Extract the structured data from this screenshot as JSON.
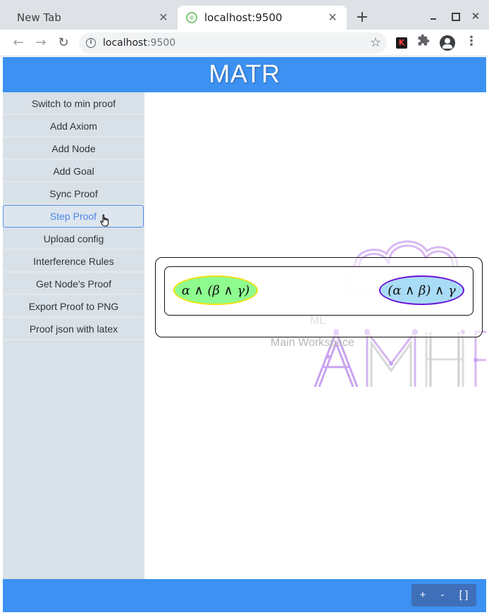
{
  "browser": {
    "tabs": [
      {
        "label": "New Tab",
        "active": false
      },
      {
        "label": "localhost:9500",
        "active": true
      }
    ],
    "tab_close_glyph": "✕",
    "new_tab_glyph": "+",
    "url_host": "localhost",
    "url_port": ":9500",
    "icons": [
      "back-arrow-icon",
      "forward-arrow-icon",
      "reload-icon",
      "info-icon",
      "star-icon",
      "puzzle-icon",
      "profile-icon",
      "kebab-menu-icon"
    ]
  },
  "app": {
    "title": "MATR",
    "accent_color": "#3c91f2",
    "sidebar": {
      "buttons": [
        {
          "label": "Switch to min proof"
        },
        {
          "label": "Add Axiom"
        },
        {
          "label": "Add Node"
        },
        {
          "label": "Add Goal"
        },
        {
          "label": "Sync Proof"
        },
        {
          "label": "Step Proof",
          "active": true
        },
        {
          "label": "Upload config"
        },
        {
          "label": "Interference Rules"
        },
        {
          "label": "Get Node's Proof"
        },
        {
          "label": "Export Proof to PNG"
        },
        {
          "label": "Proof json with latex"
        }
      ]
    },
    "workspace": {
      "watermark_ml": "ML",
      "watermark_main": "Main Workspace",
      "nodes": [
        {
          "formula": "α ∧ (β ∧ γ)",
          "role": "axiom",
          "fill": "#8efc8e",
          "border": "#f0e010"
        },
        {
          "formula": "(α ∧ β) ∧ γ",
          "role": "goal",
          "fill": "#a9dcf6",
          "border": "#6a12d6"
        }
      ]
    },
    "zoom": {
      "in_label": "+",
      "out_label": "-",
      "fit_label": "[ ]"
    }
  }
}
